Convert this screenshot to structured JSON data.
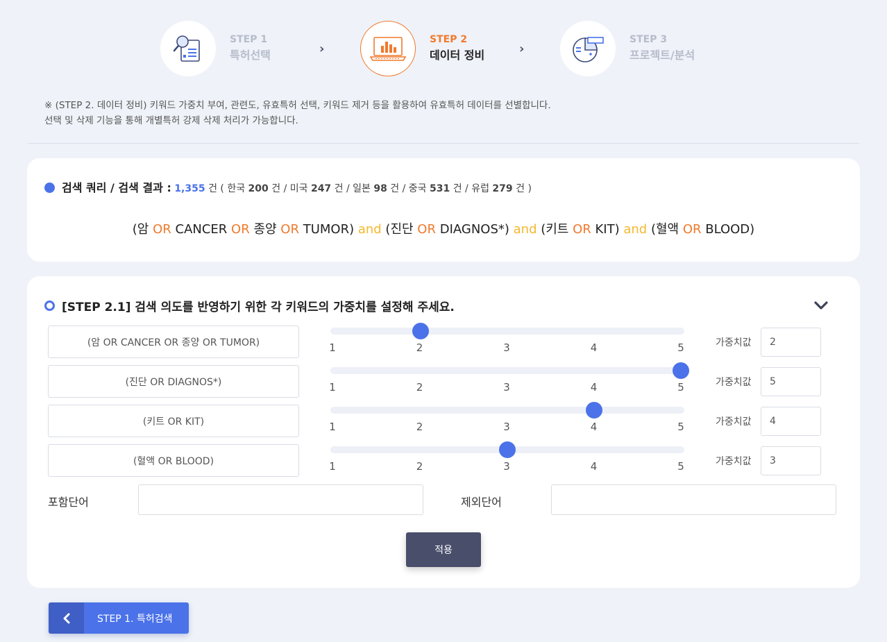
{
  "stepper": {
    "steps": [
      {
        "num": "STEP 1",
        "name": "특허선택",
        "icon": "patent-search-icon"
      },
      {
        "num": "STEP 2",
        "name": "데이터 정비",
        "icon": "data-chart-laptop-icon"
      },
      {
        "num": "STEP 3",
        "name": "프로젝트/분석",
        "icon": "analysis-report-icon"
      }
    ],
    "arrow": "›"
  },
  "notice": {
    "line1": "※ (STEP 2. 데이터 정비) 키워드 가중치 부여, 관련도, 유효특허 선택, 키워드 제거 등을 활용하여 유효특허 데이터를 선별합니다.",
    "line2": "선택 및 삭제 기능을 통해 개별특허 강제 삭제 처리가 가능합니다."
  },
  "result": {
    "label": "검색 쿼리 / 검색 결과 :",
    "total": "1,355",
    "unit": "건",
    "open": "( 한국",
    "kr": "200",
    "us_label": "건 / 미국",
    "us": "247",
    "jp_label": "건 / 일본",
    "jp": "98",
    "cn_label": "건 / 중국",
    "cn": "531",
    "eu_label": "건 / 유럽",
    "eu": "279",
    "close": "건 )"
  },
  "query": [
    {
      "t": "(암 ",
      "k": "term"
    },
    {
      "t": "OR",
      "k": "or"
    },
    {
      "t": " CANCER ",
      "k": "term"
    },
    {
      "t": "OR",
      "k": "or"
    },
    {
      "t": " 종양 ",
      "k": "term"
    },
    {
      "t": "OR",
      "k": "or"
    },
    {
      "t": " TUMOR) ",
      "k": "term"
    },
    {
      "t": "and",
      "k": "and"
    },
    {
      "t": " (진단 ",
      "k": "term"
    },
    {
      "t": "OR",
      "k": "or"
    },
    {
      "t": " DIAGNOS*) ",
      "k": "term"
    },
    {
      "t": "and",
      "k": "and"
    },
    {
      "t": " (키트 ",
      "k": "term"
    },
    {
      "t": "OR",
      "k": "or"
    },
    {
      "t": " KIT) ",
      "k": "term"
    },
    {
      "t": "and",
      "k": "and"
    },
    {
      "t": " (혈액 ",
      "k": "term"
    },
    {
      "t": "OR",
      "k": "or"
    },
    {
      "t": " BLOOD)",
      "k": "term"
    }
  ],
  "step21": {
    "title": "[STEP 2.1] 검색 의도를 반영하기 위한 각 키워드의 가중치를 설정해 주세요.",
    "weight_label": "가중치값",
    "scale": [
      "1",
      "2",
      "3",
      "4",
      "5"
    ],
    "rows": [
      {
        "keyword": "(암 OR CANCER OR 종양 OR TUMOR)",
        "weight": "2"
      },
      {
        "keyword": "(진단 OR DIAGNOS*)",
        "weight": "5"
      },
      {
        "keyword": "(키트 OR KIT)",
        "weight": "4"
      },
      {
        "keyword": "(혈액 OR BLOOD)",
        "weight": "3"
      }
    ],
    "include_label": "포함단어",
    "exclude_label": "제외단어",
    "include_value": "",
    "exclude_value": "",
    "apply_label": "적용"
  },
  "back_button": {
    "label": "STEP 1. 특허검색"
  },
  "colors": {
    "accent": "#4b72e8",
    "orange": "#f07a2d",
    "yellow": "#f5b82e",
    "dark_button": "#494e6b",
    "background": "#eff2f8"
  }
}
